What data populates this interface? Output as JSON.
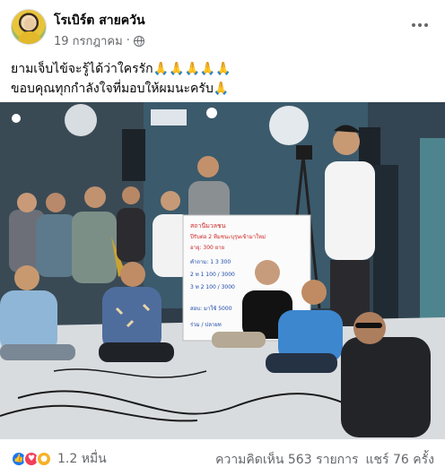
{
  "post": {
    "author": "โรเบิร์ต สายควัน",
    "date": "19 กรกฎาคม",
    "separator": "·",
    "privacy_icon": "globe-icon",
    "more_icon": "more-options-icon",
    "text_lines": [
      "ยามเจ็บไข้จะรู้ได้ว่าใครรัก🙏🙏🙏🙏🙏",
      "ขอบคุณทุกกำลังใจที่มอบให้ผมนะครับ🙏"
    ]
  },
  "photo": {
    "description_icon": "post-photo",
    "sign_lines": [
      "สถานีมวลชน",
      "ปีรับต่อ 2 ทีมชนะบุรุษเข้ามาใหม่",
      "อายุ: 300 ยาย",
      "คำถาม: 1 3 300",
      "2 ท 1 100 / 3000",
      "3 ท 2 100 / 3000",
      "สอบ: มาใช้ 5000",
      "ร่วม / ปลายท"
    ]
  },
  "footer": {
    "reaction_icons": [
      "like-icon",
      "love-icon",
      "care-icon"
    ],
    "reaction_count": "1.2 หมื่น",
    "comments": "ความคิดเห็น 563 รายการ",
    "shares": "แชร์ 76 ครั้ง"
  },
  "colors": {
    "text_primary": "#050505",
    "text_secondary": "#65676b",
    "like": "#1877f2",
    "love": "#f33e58",
    "care": "#f7b125"
  }
}
